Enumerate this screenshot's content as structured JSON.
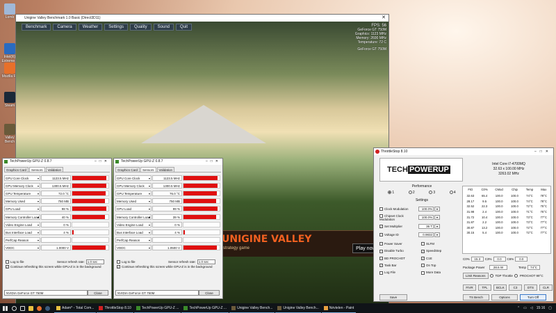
{
  "desktop": {
    "icons": [
      {
        "label": "Lomb",
        "icon": "recycle-bin-icon",
        "color": "#a0b8d8"
      },
      {
        "label": "Intel(R) Extreme T",
        "icon": "intel-icon",
        "color": "#2a6bc0"
      },
      {
        "label": "Mozilla Fir",
        "icon": "firefox-icon",
        "color": "#e8702a"
      },
      {
        "label": "Steam",
        "icon": "steam-icon",
        "color": "#1b2838"
      },
      {
        "label": "Valley Bench",
        "icon": "valley-icon",
        "color": "#6a5a3a"
      }
    ]
  },
  "valley": {
    "title": "Unigine Valley Benchmark 1.0 Basic (Direct3D11)",
    "menu": [
      "Benchmark",
      "Camera",
      "Weather",
      "Settings",
      "Quality",
      "Sound",
      "Quit"
    ],
    "hud": {
      "fps": "FPS: 56",
      "gpu": "GeForce GT 750M",
      "lines": [
        "Graphics: 1123 MHz",
        "Memory: 2600 MHz",
        "Temperature: 72 C"
      ],
      "gpu2": "GeForce GT 750M"
    },
    "banner": {
      "logo": "UNIGINE VALLEY",
      "sub": "strategy game",
      "play": "Play now ▸"
    }
  },
  "gpuz_left": {
    "title": "TechPowerUp GPU-Z 0.8.7",
    "tabs": [
      "Graphics Card",
      "Sensors",
      "Validation"
    ],
    "sensors": [
      {
        "label": "GPU Core Clock",
        "value": "1123.5 MHz",
        "fill": 0.95
      },
      {
        "label": "GPU Memory Clock",
        "value": "1300.5 MHz",
        "fill": 0.95
      },
      {
        "label": "GPU Temperature",
        "value": "72.0 °C",
        "fill": 0.92
      },
      {
        "label": "Memory Used",
        "value": "750 MB",
        "fill": 0.9
      },
      {
        "label": "GPU Load",
        "value": "98 %",
        "fill": 0.95
      },
      {
        "label": "Memory Controller Load",
        "value": "40 %",
        "fill": 0.9
      },
      {
        "label": "Video Engine Load",
        "value": "0 %",
        "fill": 0
      },
      {
        "label": "Bus Interface Load",
        "value": "4 %",
        "fill": 0.04
      },
      {
        "label": "PerfCap Reason",
        "value": "",
        "fill": 0
      },
      {
        "label": "VDDC",
        "value": "1.0000 V",
        "fill": 0.92
      }
    ],
    "log_to_file": "Log to file",
    "continue_refresh": "Continue refreshing this screen while GPU-Z is in the background",
    "refresh_label": "Sensor refresh rate:",
    "refresh_value": "1.0 sec",
    "device": "NVIDIA GeForce GT 750M",
    "close": "Close"
  },
  "gpuz_right": {
    "title": "TechPowerUp GPU-Z 0.8.7",
    "tabs": [
      "Graphics Card",
      "Sensors",
      "Validation"
    ],
    "sensors": [
      {
        "label": "GPU Core Clock",
        "value": "1123.5 MHz",
        "fill": 0.95
      },
      {
        "label": "GPU Memory Clock",
        "value": "1300.5 MHz",
        "fill": 0.95
      },
      {
        "label": "GPU Temperature",
        "value": "76.0 °C",
        "fill": 0.92
      },
      {
        "label": "Memory Used",
        "value": "750 MB",
        "fill": 0.9
      },
      {
        "label": "GPU Load",
        "value": "99 %",
        "fill": 0.95
      },
      {
        "label": "Memory Controller Load",
        "value": "39 %",
        "fill": 0.9
      },
      {
        "label": "Video Engine Load",
        "value": "0 %",
        "fill": 0
      },
      {
        "label": "Bus Interface Load",
        "value": "4 %",
        "fill": 0.04
      },
      {
        "label": "PerfCap Reason",
        "value": "",
        "fill": 0
      },
      {
        "label": "VDDC",
        "value": "1.0500 V",
        "fill": 0.92
      }
    ],
    "log_to_file": "Log to file",
    "continue_refresh": "Continue refreshing this screen while GPU-Z is in the background",
    "refresh_label": "Sensor refresh rate:",
    "refresh_value": "1.0 sec",
    "device": "NVIDIA GeForce GT 750M",
    "close": "Close"
  },
  "throttlestop": {
    "title": "ThrottleStop 8.10",
    "logo_a": "TECH",
    "logo_b": "POWERUP",
    "cpu_name": "Intel Core i7-4700MQ",
    "cpu_mult": "32.63 x 100.00 MHz",
    "cpu_freq": "3263.02 MHz",
    "performance_label": "Performance",
    "profiles": [
      "1",
      "2",
      "3",
      "4"
    ],
    "settings_label": "Settings",
    "settings": [
      {
        "name": "Clock Modulation",
        "value": "100.0%",
        "checked": false
      },
      {
        "name": "Chipset Clock Modulation",
        "value": "100.0%",
        "checked": false
      },
      {
        "name": "Set Multiplier",
        "value": "36 T",
        "checked": true
      },
      {
        "name": "Voltage ID",
        "value": "0.9832",
        "checked": false
      }
    ],
    "options_left": [
      {
        "name": "Power Saver",
        "checked": false
      },
      {
        "name": "Disable Turbo",
        "checked": false
      },
      {
        "name": "BD PROCHOT",
        "checked": false
      },
      {
        "name": "Task Bar",
        "checked": true
      },
      {
        "name": "Log File",
        "checked": false
      }
    ],
    "options_right": [
      {
        "name": "SLFM",
        "checked": false
      },
      {
        "name": "SpeedStep",
        "checked": true
      },
      {
        "name": "C1E",
        "checked": true
      },
      {
        "name": "On Top",
        "checked": false
      },
      {
        "name": "More Data",
        "checked": false
      }
    ],
    "table_headers": [
      "FID",
      "C0%",
      "CMod",
      "Chip",
      "Temp",
      "Max"
    ],
    "table_rows": [
      [
        "32.63",
        "65.4",
        "100.0",
        "100.0",
        "74°C",
        "78°C"
      ],
      [
        "28.17",
        "9.5",
        "100.0",
        "100.0",
        "74°C",
        "78°C"
      ],
      [
        "32.52",
        "22.3",
        "100.0",
        "100.0",
        "72°C",
        "75°C"
      ],
      [
        "31.98",
        "2.4",
        "100.0",
        "100.0",
        "71°C",
        "75°C"
      ],
      [
        "31.72",
        "10.4",
        "100.0",
        "100.0",
        "73°C",
        "77°C"
      ],
      [
        "31.87",
        "2.2",
        "100.0",
        "100.0",
        "73°C",
        "77°C"
      ],
      [
        "30.87",
        "13.2",
        "100.0",
        "100.0",
        "72°C",
        "77°C"
      ],
      [
        "30.15",
        "5.4",
        "100.0",
        "100.0",
        "72°C",
        "77°C"
      ]
    ],
    "c0_label": "C0%",
    "c0_value": "15.3",
    "c3_label": "C3%",
    "c3_value": "0.0",
    "c6_label": "C6%",
    "c6_value": "0.0",
    "pkg_label": "Package Power",
    "pkg_value": "28.6 W",
    "temp_label": "Temp",
    "temp_value": "74°C",
    "limit_btn": "Limit Reasons",
    "tdp_label": "TDP Throttle",
    "prochot_label": "PROCHOT 99°C",
    "buttons": [
      "FIVR",
      "TPL",
      "BCLK",
      "C3",
      "DTS",
      "CLR"
    ],
    "save": "Save",
    "bottom_buttons": [
      "TS Bench",
      "Options",
      "Turn Off"
    ]
  },
  "taskbar": {
    "tasks": [
      {
        "label": "Adam^ - Total Com...",
        "color": "#e8c040"
      },
      {
        "label": "ThrottleStop 8.10",
        "color": "#d02020"
      },
      {
        "label": "TechPowerUp GPU-Z ...",
        "color": "#3a8a2a"
      },
      {
        "label": "TechPowerUp GPU-Z ...",
        "color": "#3a8a2a"
      },
      {
        "label": "Unigine Valley Bench...",
        "color": "#6a5a3a"
      },
      {
        "label": "Unigine Valley Bench...",
        "color": "#6a5a3a"
      },
      {
        "label": "Névtelen - Paint",
        "color": "#e8a040"
      }
    ],
    "time": "15:16"
  }
}
